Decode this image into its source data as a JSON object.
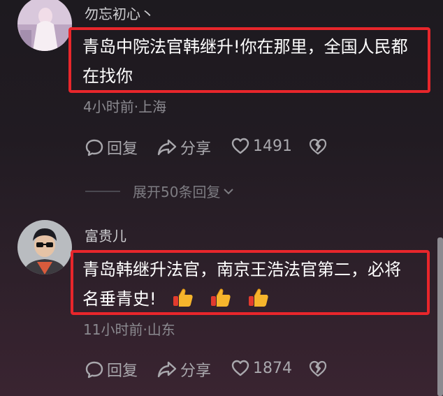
{
  "comments": [
    {
      "username": "勿忘初心丶",
      "text_line1": "青岛中院法官韩继升!你在那里，全国人民都",
      "text_line2": "在找你",
      "meta": "4小时前·上海",
      "reply_label": "回复",
      "share_label": "分享",
      "like_count": "1491"
    },
    {
      "username": "富贵儿",
      "text_line1": "青岛韩继升法官，南京王浩法官第二，必将",
      "text_line2": "名垂青史!",
      "emojis": [
        "thumbs-up",
        "thumbs-up",
        "thumbs-up"
      ],
      "meta": "11小时前·山东",
      "reply_label": "回复",
      "share_label": "分享",
      "like_count": "1874"
    }
  ],
  "expand_replies": {
    "label": "展开50条回复"
  },
  "icons": {
    "reply": "speech-bubble-icon",
    "share": "share-arrow-icon",
    "like": "heart-outline-icon",
    "dislike": "broken-heart-icon",
    "expand": "chevron-down-icon",
    "emoji": "thumbs-up-emoji-icon"
  },
  "colors": {
    "highlight": "#e8262b",
    "meta_text": "#8b8a90",
    "action_text": "#a9a8ad"
  }
}
